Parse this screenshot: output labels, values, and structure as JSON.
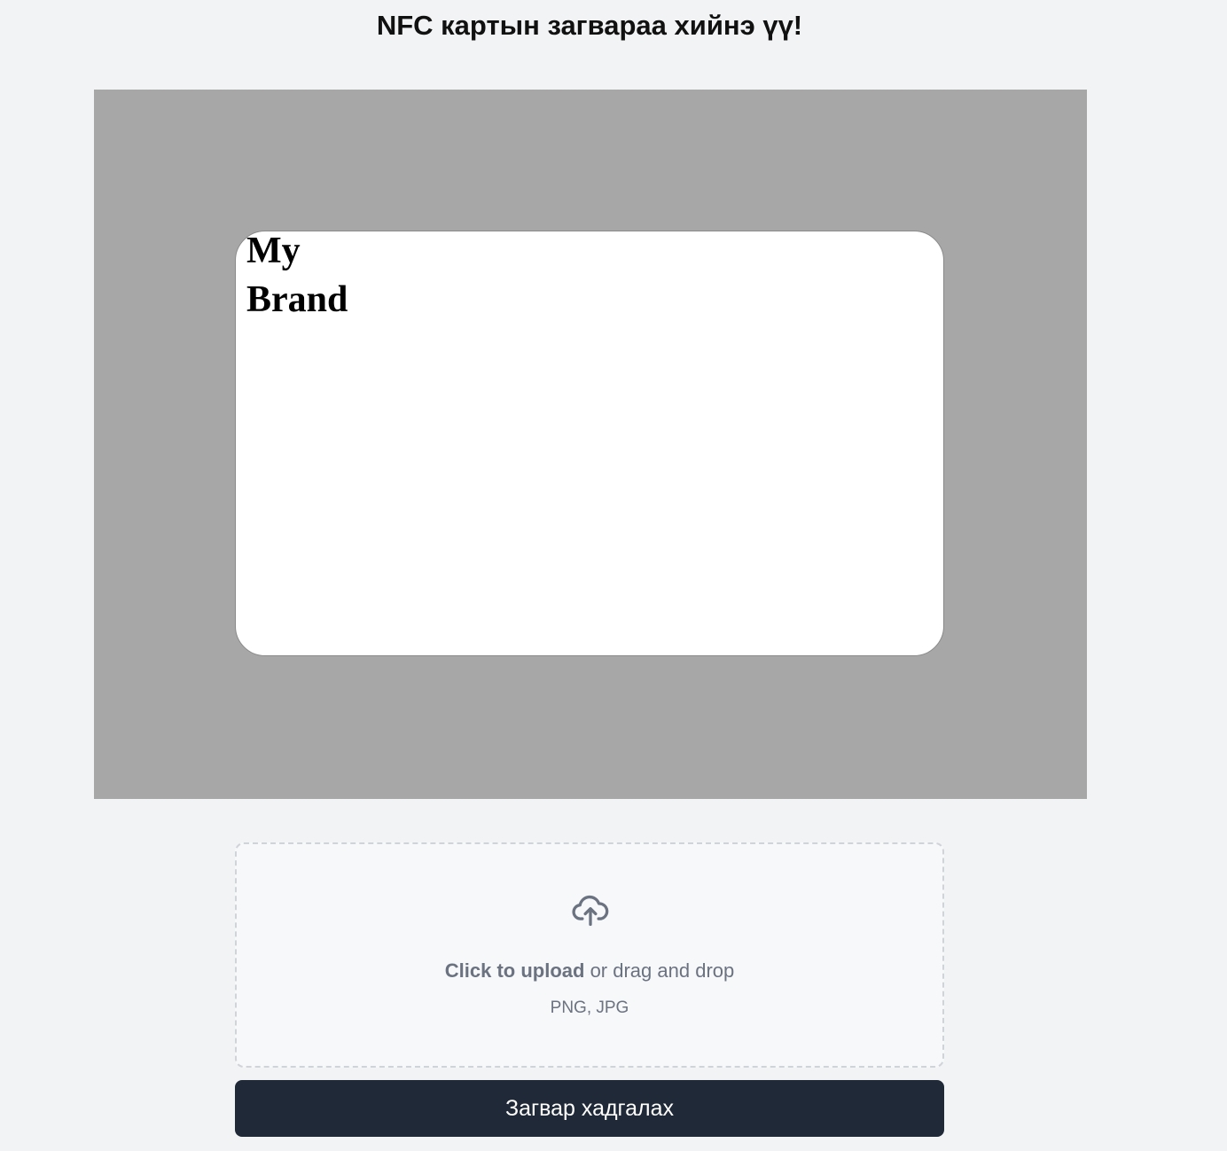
{
  "page": {
    "title": "NFC картын загвараа хийнэ үү!"
  },
  "card": {
    "brand_text": "My Brand"
  },
  "upload": {
    "icon": "cloud-upload-icon",
    "click_text": "Click to upload",
    "drag_text": " or drag and drop",
    "file_types": "PNG, JPG"
  },
  "actions": {
    "save_label": "Загвар хадгалах"
  },
  "colors": {
    "page_background": "#f2f3f5",
    "canvas_background": "#a8a7a8",
    "card_background": "#ffffff",
    "button_background": "#1f2937",
    "muted_text": "#6b7280"
  }
}
